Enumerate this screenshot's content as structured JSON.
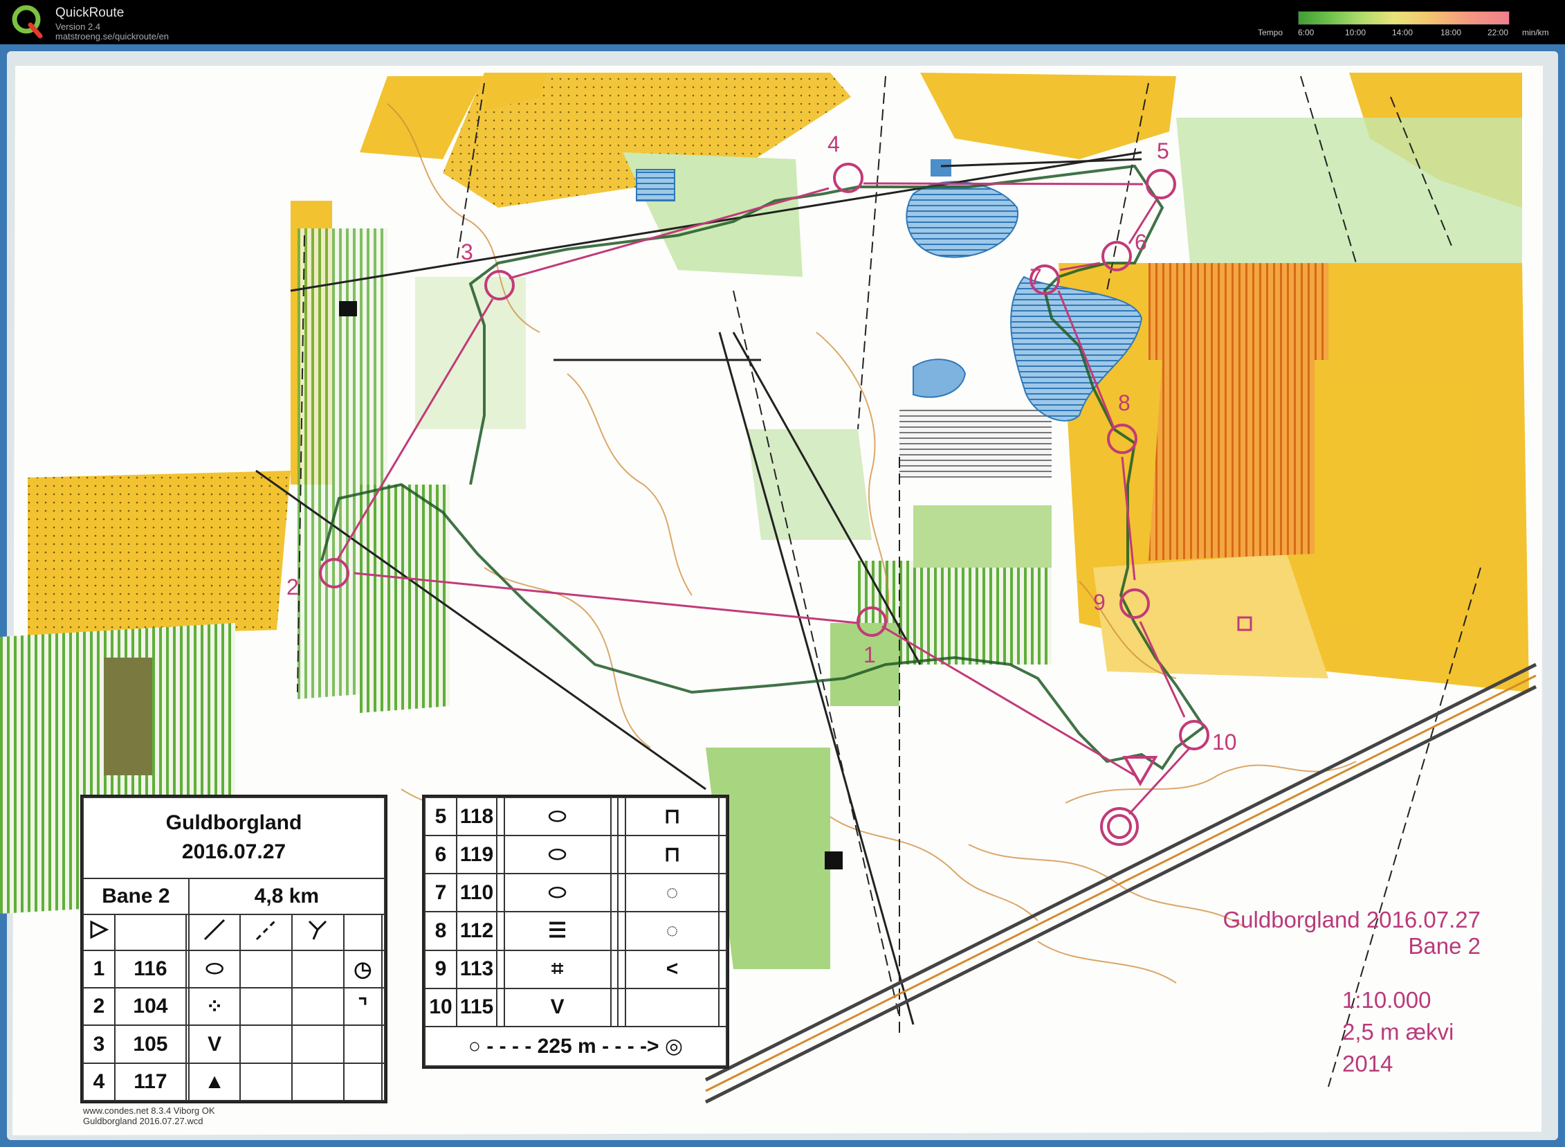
{
  "app": {
    "title": "QuickRoute",
    "version": "Version 2.4",
    "url": "matstroeng.se/quickroute/en"
  },
  "tempo": {
    "label": "Tempo",
    "ticks": [
      "6:00",
      "10:00",
      "14:00",
      "18:00",
      "22:00"
    ],
    "unit": "min/km"
  },
  "course": {
    "event": "Guldborgland",
    "date": "2016.07.27",
    "course_name": "Bane 2",
    "length": "4,8 km",
    "controls_left": [
      {
        "n": "1",
        "code": "116"
      },
      {
        "n": "2",
        "code": "104"
      },
      {
        "n": "3",
        "code": "105"
      },
      {
        "n": "4",
        "code": "117"
      }
    ],
    "controls_right": [
      {
        "n": "5",
        "code": "118"
      },
      {
        "n": "6",
        "code": "119"
      },
      {
        "n": "7",
        "code": "110"
      },
      {
        "n": "8",
        "code": "112"
      },
      {
        "n": "9",
        "code": "113"
      },
      {
        "n": "10",
        "code": "115"
      }
    ],
    "finish_distance": "225 m"
  },
  "map_labels": {
    "title_line1": "Guldborgland 2016.07.27",
    "title_line2": "Bane 2",
    "scale": "1:10.000",
    "contour": "2,5 m ækvi",
    "year": "2014",
    "credit_line1": "www.condes.net 8.3.4 Viborg OK",
    "credit_line2": "Guldborgland 2016.07.27.wcd"
  },
  "control_numbers": [
    "1",
    "2",
    "3",
    "4",
    "5",
    "6",
    "7",
    "8",
    "9",
    "10"
  ],
  "icons": [
    "quickroute-logo-icon",
    "start-triangle-icon",
    "control-circle-icon",
    "finish-double-circle-icon"
  ],
  "colors": {
    "course_purple": "#c23a78",
    "open_yellow": "#f2c230",
    "forest_green": "#8cc86a",
    "water_blue": "#4a8fc9"
  }
}
